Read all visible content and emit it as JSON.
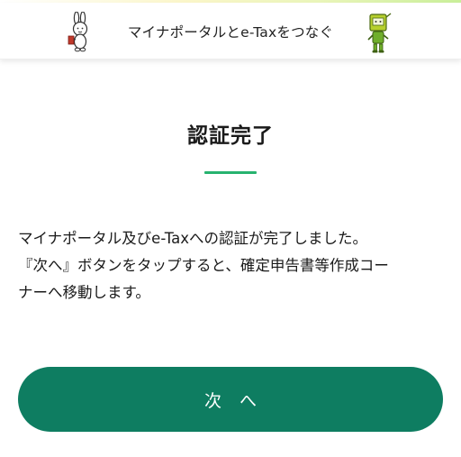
{
  "header": {
    "title": "マイナポータルとe-Taxをつなぐ",
    "left_mascot_icon": "rabbit-mascot-icon",
    "right_mascot_icon": "robot-mascot-icon"
  },
  "main": {
    "title": "認証完了",
    "message_lines": [
      "マイナポータル及びe-Taxへの認証が完了しました。",
      "『次へ』ボタンをタップすると、確定申告書等作成コー",
      "ナーへ移動します。"
    ]
  },
  "actions": {
    "next_label": "次へ"
  },
  "colors": {
    "accent_green": "#27b36f",
    "button_green": "#0e7d61"
  }
}
